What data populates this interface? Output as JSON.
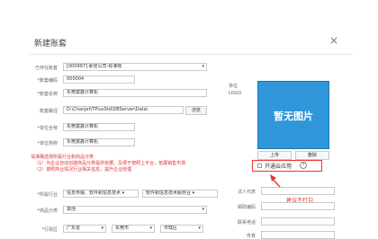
{
  "dialog": {
    "title": "新建账套",
    "close_icon": "×"
  },
  "form": {
    "existing_label": "已存在账套",
    "existing_value": "[000997] 那佳公司-标准帐",
    "code_label": "*账套编码",
    "code_value": "000004",
    "name_label": "*账套名称",
    "name_value": "东莞富鑫计算机",
    "path_label": "账套路径",
    "path_value": "D:\\Chanjet\\TPlusStd\\DBServer\\Data\\",
    "browse_label": "浏览",
    "unit_name_label": "*单位全称",
    "unit_name_value": "东莞富鑫计算机",
    "unit_short_label": "*单位简称",
    "unit_short_value": "东莞富鑫计算机",
    "notes": [
      "请准确选择所属行业和商品分类",
      "（1）为企业自动创建商品分类提供依据，及便于按照上平台，拓展销售市场",
      "（2）按照商业情况行业相关信息，提升企业管理"
    ],
    "industry_label": "*所属行业",
    "industry_values": [
      "信息传输、软件和信息技术 ▾",
      "软件和信息技术服务业 ▾"
    ],
    "category_label": "*商品分类",
    "category_value": "其他",
    "region_label": "*行政区",
    "region_values": [
      "广东省",
      "东莞市",
      "市辖区"
    ]
  },
  "logo": {
    "label": "单位LOGO",
    "placeholder": "暂无图片",
    "upload_label": "上传",
    "delete_label": "删除",
    "checkbox_label": "开通云应用",
    "help_icon": "?"
  },
  "right_fields": {
    "legal_label": "法人代表",
    "postal_label": "邮政编码",
    "phone_label": "联系电话",
    "fax_label": "传真"
  },
  "annotation": {
    "text": "建议不打勾"
  },
  "colors": {
    "accent": "#2f96da",
    "warning": "#e33333"
  }
}
